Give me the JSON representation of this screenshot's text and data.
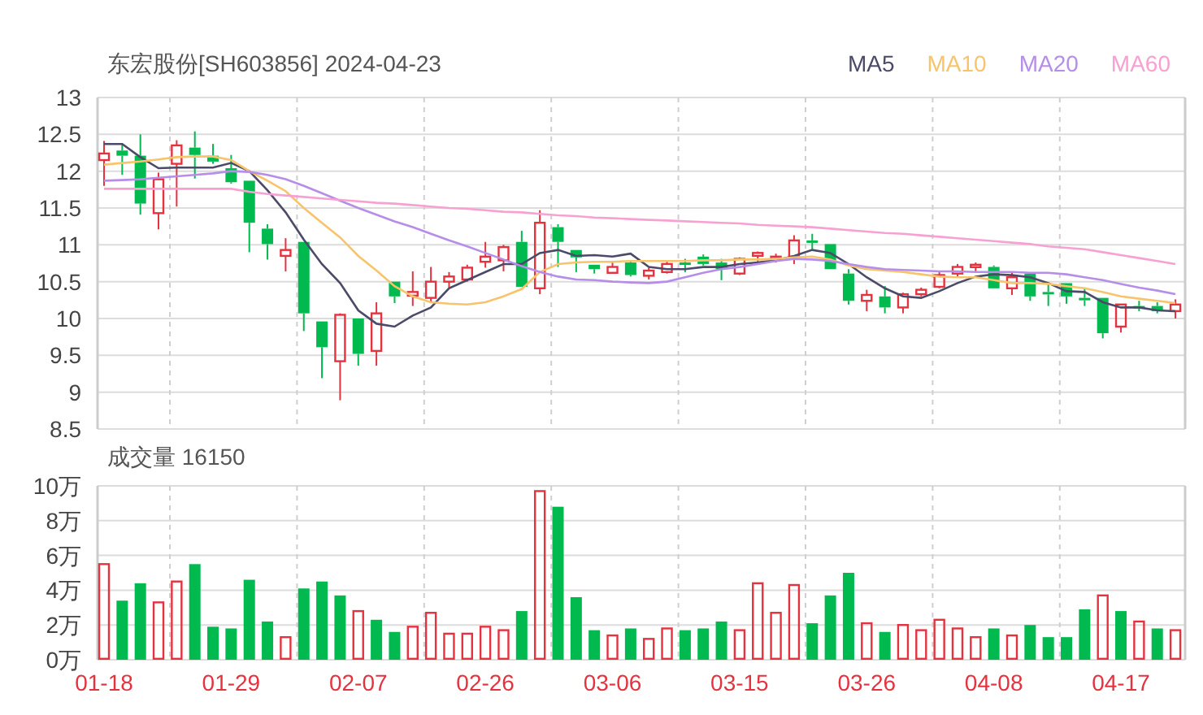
{
  "header": {
    "title": "东宏股份[SH603856] 2024-04-23"
  },
  "price_panel": {
    "chart_data": {
      "type": "candlestick",
      "grid": true,
      "ylim": [
        8.5,
        13
      ],
      "yticks": [
        8.5,
        9,
        9.5,
        10,
        10.5,
        11,
        11.5,
        12,
        12.5,
        13
      ],
      "categories": [
        null,
        null,
        null,
        null,
        null,
        null,
        null,
        null,
        null,
        null,
        null,
        null,
        null,
        null,
        null,
        null,
        null,
        null,
        null,
        null,
        null,
        null,
        null,
        null,
        null,
        null,
        null,
        null,
        null,
        null,
        null,
        null,
        null,
        null,
        null,
        null,
        null,
        null,
        null,
        null,
        null,
        null,
        null,
        null,
        null,
        null,
        null,
        null,
        null,
        null,
        null,
        null,
        null,
        null,
        null,
        null,
        null,
        null,
        null,
        null
      ],
      "series": [
        {
          "name": "MA5",
          "type": "line",
          "color": "#4b4a68",
          "values": [
            12.37,
            12.37,
            12.19,
            12.04,
            12.05,
            12.05,
            12.05,
            12.11,
            12.0,
            11.74,
            11.44,
            11.07,
            10.74,
            10.48,
            10.11,
            9.93,
            9.89,
            10.04,
            10.15,
            10.41,
            10.52,
            10.63,
            10.74,
            10.74,
            10.89,
            10.93,
            10.85,
            10.86,
            10.84,
            10.88,
            10.7,
            10.67,
            10.67,
            10.7,
            10.7,
            10.74,
            10.76,
            10.79,
            10.85,
            10.93,
            10.89,
            10.74,
            10.56,
            10.41,
            10.3,
            10.28,
            10.37,
            10.48,
            10.57,
            10.6,
            10.59,
            10.56,
            10.48,
            10.37,
            10.36,
            10.22,
            10.15,
            10.15,
            10.11,
            10.1
          ]
        },
        {
          "name": "MA10",
          "type": "line",
          "color": "#f7c46c",
          "values": [
            12.09,
            12.11,
            12.13,
            12.16,
            12.19,
            12.2,
            12.2,
            12.15,
            12.0,
            11.87,
            11.73,
            11.5,
            11.3,
            11.1,
            10.85,
            10.65,
            10.44,
            10.3,
            10.22,
            10.2,
            10.19,
            10.22,
            10.3,
            10.4,
            10.63,
            10.74,
            10.76,
            10.77,
            10.77,
            10.78,
            10.78,
            10.78,
            10.78,
            10.79,
            10.79,
            10.8,
            10.8,
            10.81,
            10.83,
            10.84,
            10.8,
            10.72,
            10.67,
            10.65,
            10.63,
            10.6,
            10.57,
            10.56,
            10.56,
            10.52,
            10.48,
            10.48,
            10.47,
            10.44,
            10.41,
            10.36,
            10.3,
            10.27,
            10.24,
            10.21
          ]
        },
        {
          "name": "MA20",
          "type": "line",
          "color": "#b68de8",
          "values": [
            11.87,
            11.88,
            11.89,
            11.91,
            11.93,
            11.95,
            11.97,
            12.0,
            11.99,
            11.95,
            11.89,
            11.8,
            11.7,
            11.6,
            11.5,
            11.41,
            11.32,
            11.24,
            11.15,
            11.06,
            10.98,
            10.89,
            10.8,
            10.71,
            10.63,
            10.57,
            10.53,
            10.52,
            10.5,
            10.49,
            10.48,
            10.5,
            10.56,
            10.62,
            10.67,
            10.7,
            10.74,
            10.78,
            10.81,
            10.8,
            10.78,
            10.74,
            10.7,
            10.67,
            10.66,
            10.65,
            10.64,
            10.64,
            10.63,
            10.63,
            10.63,
            10.62,
            10.62,
            10.6,
            10.56,
            10.52,
            10.47,
            10.42,
            10.38,
            10.33
          ]
        },
        {
          "name": "MA60",
          "type": "line",
          "color": "#f7a1d3",
          "values": [
            11.76,
            11.76,
            11.76,
            11.76,
            11.76,
            11.76,
            11.76,
            11.76,
            11.72,
            11.69,
            11.67,
            11.65,
            11.63,
            11.61,
            11.59,
            11.57,
            11.56,
            11.54,
            11.52,
            11.5,
            11.49,
            11.47,
            11.45,
            11.44,
            11.42,
            11.4,
            11.39,
            11.37,
            11.36,
            11.35,
            11.34,
            11.33,
            11.32,
            11.31,
            11.3,
            11.29,
            11.27,
            11.26,
            11.25,
            11.24,
            11.22,
            11.2,
            11.18,
            11.16,
            11.15,
            11.13,
            11.11,
            11.09,
            11.07,
            11.05,
            11.03,
            11.01,
            10.98,
            10.96,
            10.94,
            10.9,
            10.86,
            10.82,
            10.78,
            10.74
          ]
        }
      ],
      "ohlc": [
        [
          12.15,
          12.41,
          11.8,
          12.24
        ],
        [
          12.28,
          12.37,
          11.95,
          12.21
        ],
        [
          12.21,
          12.5,
          11.41,
          11.56
        ],
        [
          11.43,
          11.98,
          11.21,
          11.89
        ],
        [
          12.1,
          12.42,
          11.52,
          12.35
        ],
        [
          12.32,
          12.54,
          11.9,
          12.22
        ],
        [
          12.21,
          12.37,
          12.1,
          12.13
        ],
        [
          12.04,
          12.22,
          11.83,
          11.85
        ],
        [
          11.87,
          11.87,
          10.9,
          11.3
        ],
        [
          11.22,
          11.28,
          10.8,
          11.01
        ],
        [
          10.85,
          11.09,
          10.64,
          10.93
        ],
        [
          11.04,
          11.04,
          9.83,
          10.07
        ],
        [
          9.96,
          9.96,
          9.19,
          9.61
        ],
        [
          9.42,
          10.07,
          8.89,
          10.05
        ],
        [
          10.0,
          10.0,
          9.36,
          9.52
        ],
        [
          9.56,
          10.22,
          9.36,
          10.07
        ],
        [
          10.5,
          10.5,
          10.21,
          10.3
        ],
        [
          10.31,
          10.64,
          10.17,
          10.36
        ],
        [
          10.28,
          10.7,
          10.23,
          10.5
        ],
        [
          10.5,
          10.63,
          10.42,
          10.57
        ],
        [
          10.53,
          10.73,
          10.5,
          10.69
        ],
        [
          10.77,
          11.04,
          10.69,
          10.84
        ],
        [
          10.79,
          11.0,
          10.64,
          10.97
        ],
        [
          11.04,
          11.19,
          10.43,
          10.43
        ],
        [
          10.41,
          11.47,
          10.33,
          11.3
        ],
        [
          11.24,
          11.28,
          10.7,
          11.04
        ],
        [
          10.93,
          10.93,
          10.63,
          10.83
        ],
        [
          10.73,
          10.73,
          10.61,
          10.67
        ],
        [
          10.62,
          10.76,
          10.62,
          10.7
        ],
        [
          10.76,
          10.78,
          10.57,
          10.59
        ],
        [
          10.58,
          10.69,
          10.53,
          10.65
        ],
        [
          10.63,
          10.78,
          10.61,
          10.74
        ],
        [
          10.76,
          10.81,
          10.63,
          10.73
        ],
        [
          10.84,
          10.87,
          10.72,
          10.74
        ],
        [
          10.76,
          10.81,
          10.52,
          10.67
        ],
        [
          10.61,
          10.83,
          10.59,
          10.81
        ],
        [
          10.85,
          10.91,
          10.73,
          10.89
        ],
        [
          10.81,
          10.88,
          10.76,
          10.84
        ],
        [
          10.84,
          11.13,
          10.74,
          11.06
        ],
        [
          11.06,
          11.15,
          10.94,
          11.04
        ],
        [
          11.01,
          11.01,
          10.67,
          10.67
        ],
        [
          10.61,
          10.67,
          10.19,
          10.24
        ],
        [
          10.24,
          10.39,
          10.1,
          10.32
        ],
        [
          10.3,
          10.44,
          10.07,
          10.15
        ],
        [
          10.15,
          10.35,
          10.07,
          10.33
        ],
        [
          10.33,
          10.42,
          10.3,
          10.39
        ],
        [
          10.43,
          10.63,
          10.41,
          10.59
        ],
        [
          10.61,
          10.74,
          10.57,
          10.7
        ],
        [
          10.7,
          10.76,
          10.63,
          10.73
        ],
        [
          10.7,
          10.72,
          10.41,
          10.41
        ],
        [
          10.41,
          10.63,
          10.32,
          10.56
        ],
        [
          10.61,
          10.61,
          10.24,
          10.3
        ],
        [
          10.36,
          10.47,
          10.17,
          10.33
        ],
        [
          10.48,
          10.48,
          10.2,
          10.3
        ],
        [
          10.28,
          10.41,
          10.17,
          10.26
        ],
        [
          10.28,
          10.28,
          9.73,
          9.8
        ],
        [
          9.89,
          10.19,
          9.81,
          10.19
        ],
        [
          10.17,
          10.24,
          10.1,
          10.16
        ],
        [
          10.17,
          10.22,
          10.07,
          10.1
        ],
        [
          10.1,
          10.26,
          10.0,
          10.19
        ]
      ]
    }
  },
  "volume_panel": {
    "title": "成交量 16150",
    "chart_data": {
      "type": "bar",
      "grid": true,
      "ylim": [
        0,
        10
      ],
      "categories": [
        "01-18",
        null,
        null,
        null,
        null,
        null,
        null,
        "01-29",
        null,
        null,
        null,
        null,
        null,
        null,
        "02-07",
        null,
        null,
        null,
        null,
        null,
        null,
        "02-26",
        null,
        null,
        null,
        null,
        null,
        null,
        "03-06",
        null,
        null,
        null,
        null,
        null,
        null,
        "03-15",
        null,
        null,
        null,
        null,
        null,
        null,
        "03-26",
        null,
        null,
        null,
        null,
        null,
        null,
        "04-08",
        null,
        null,
        null,
        null,
        null,
        null,
        "04-17",
        null,
        null,
        null
      ],
      "yticks": [
        {
          "value": 0,
          "label": "0万"
        },
        {
          "value": 2,
          "label": "2万"
        },
        {
          "value": 4,
          "label": "4万"
        },
        {
          "value": 6,
          "label": "6万"
        },
        {
          "value": 8,
          "label": "8万"
        },
        {
          "value": 10,
          "label": "10万"
        }
      ],
      "series": [
        {
          "color": "#e5323f",
          "values": [
            5.5,
            null,
            null,
            3.3,
            4.5,
            null,
            null,
            null,
            null,
            null,
            1.3,
            null,
            null,
            null,
            2.8,
            null,
            null,
            1.9,
            2.7,
            1.5,
            1.5,
            1.9,
            1.7,
            null,
            9.7,
            null,
            null,
            null,
            1.4,
            null,
            1.2,
            1.8,
            null,
            null,
            null,
            1.7,
            4.4,
            2.7,
            4.3,
            null,
            null,
            null,
            2.1,
            null,
            2.0,
            1.7,
            2.3,
            1.8,
            1.3,
            null,
            1.4,
            null,
            null,
            null,
            null,
            3.7,
            null,
            2.2,
            null,
            1.7
          ]
        },
        {
          "color": "#00b94f",
          "values": [
            null,
            3.4,
            4.4,
            null,
            null,
            5.5,
            1.9,
            1.8,
            4.6,
            2.2,
            null,
            4.1,
            4.5,
            3.7,
            null,
            2.3,
            1.6,
            null,
            null,
            null,
            null,
            null,
            null,
            2.8,
            null,
            8.8,
            3.6,
            1.7,
            null,
            1.8,
            null,
            null,
            1.7,
            1.8,
            2.2,
            null,
            null,
            null,
            null,
            2.1,
            3.7,
            5.0,
            null,
            1.6,
            null,
            null,
            null,
            null,
            null,
            1.8,
            null,
            2.0,
            1.3,
            1.3,
            2.9,
            null,
            2.8,
            null,
            1.8,
            null
          ]
        }
      ]
    }
  }
}
